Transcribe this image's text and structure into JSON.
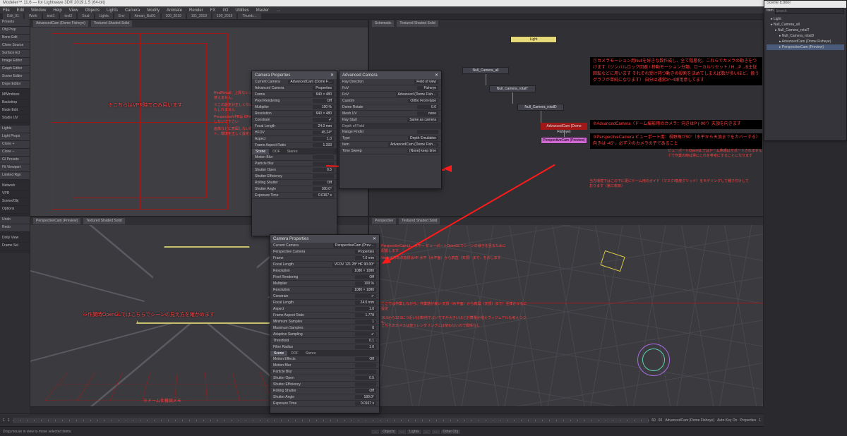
{
  "window": {
    "title": "Modeler™ 11.6 — for Lightwave 3D® 2019.1.5 (64-bit)"
  },
  "menu": [
    "File",
    "Edit",
    "Window",
    "Help",
    "View",
    "Objects",
    "Lights",
    "Camera",
    "Modify",
    "Animate",
    "Render",
    "FX",
    "I/O",
    "Utilities",
    "Master",
    "…"
  ],
  "tabs": [
    "Edit_01",
    "Work",
    "test1",
    "test2",
    "Stud",
    "Lights",
    "Env",
    "Atman_Bul01",
    "100_2019",
    "101_2019",
    "100_2019",
    "Thumb…"
  ],
  "left_tools": {
    "group1": [
      "Presets",
      "Obj Prop",
      "Bone Edit",
      "Clone Source",
      "Surface Ed",
      "Image Editor",
      "Graph Editor",
      "Scene Editor",
      "Dope Editor"
    ],
    "group2": [
      "MWindows",
      "Backdrop",
      "Node Edit",
      "Studio UV"
    ],
    "group3": [
      "Lights",
      "Light Props",
      "Clone +",
      "Clone −",
      "GI Presets",
      "Fit Viewport",
      "Limited Rgn"
    ],
    "group4": [
      "Network",
      "VPR",
      "Scene/Obj",
      "Options"
    ],
    "group5": [
      "Undo",
      "Redo"
    ],
    "group6": [
      "Dolly View",
      "Frame Sel"
    ]
  },
  "viewports": {
    "tl": {
      "camera": "AdvancedCam (Dome Fisheye)",
      "mode": "Textured Shaded Solid",
      "note1": "※こちらはVPR時でのみ用います",
      "side_notes": [
        "RealRecall：上質なレンダリング時はAdvancedCameraでしか使えません。",
        "※この設定が正しくない場合、これが正常に動作していないかもしれません",
        "PerspectiveVPRは HFov=90° で、（水平の線位と斜線）は被写しないで下さい",
        "画像などに意図しない影が出る場合は、上記を確認して（ライト、環境を正しく設定したことと対応してみて下さい）"
      ]
    },
    "tr": {
      "title": "Schematic",
      "mode": "Textured Shaded Solid",
      "nodes": {
        "light": "Light",
        "n1": "Null_Camera_all",
        "n2": "Null_Camera_rotalT",
        "n3": "Null_Camera_rotalD",
        "n4": "AdvancedCam (Dome Fisheye)",
        "n5": "PerspectiveCam (Preview)"
      },
      "annotations": {
        "box1": "①カメラモーション用Nullを好きな数作成し、全て階層化。これらでカメラの動きをつけます（ジンバルロック回避 / 移動モーション分類、ローカルリセット / H→P→B主従回転などに用います それぞれ受け持つ動きの役割を決めてしまえば数が多いほど、扱うグラフが単純になります） 自分は通常3〜4娘用意してます",
        "box2": "②AdvancedCamera（ドーム撮影用のカメラ：向きはP (-90°）天頂を向きます",
        "box3": "③PerspectiveCamera ビューポート用：視野角が90°（水平から天頂までをカバーする）向きは -45°、必ず②のカメラの子であること",
        "sub_note1": "ビューポートOpenGLではドーム魚眼はサポートされません ①で作業の時は常にこれを参考にすることになります",
        "sub_note2": "当方環境ではこの下に更にドーム用のガイド（マスク/角度グリッド）をモデリングして親子付けしております（第三枚目）"
      }
    },
    "bl": {
      "camera": "PerspectiveCam (Preview)",
      "mode": "Textured Shaded Solid",
      "note2": "※作業時OpenGLではこちらでシーンの見え方を確かめます",
      "bottom_note": "※ドーム仕様図メモ"
    },
    "br": {
      "camera": "Perspective",
      "mode": "Textured Shaded Solid"
    }
  },
  "panel_advanced": {
    "title": "Camera Properties",
    "current_camera": "AdvancedCam (Dome F…",
    "rows": [
      {
        "lab": "Advanced Camera",
        "val": "Properties"
      },
      {
        "lab": "Frame",
        "val": "640 × 480"
      },
      {
        "lab": "Pixel Rendering",
        "val": "Off"
      },
      {
        "lab": "Multiplier",
        "val": "100 %"
      },
      {
        "lab": "Resolution",
        "val": "640 × 480"
      },
      {
        "lab": "Constrain",
        "val": "✔"
      },
      {
        "lab": "Focal Length",
        "val": "24.0 mm"
      },
      {
        "lab": "HFOV",
        "val": "45.24°"
      },
      {
        "lab": "Aspect",
        "val": "1.0"
      },
      {
        "lab": "Frame Aspect Ratio",
        "val": "1.333"
      }
    ],
    "tabs": [
      "Scene",
      "DOF",
      "Stereo"
    ],
    "tab_rows": [
      {
        "lab": "Motion Blur",
        "val": ""
      },
      {
        "lab": "Particle Blur",
        "val": ""
      },
      {
        "lab": "Shutter Open",
        "val": "0.5"
      },
      {
        "lab": "Shutter Efficiency",
        "val": ""
      },
      {
        "lab": "Rolling Shutter",
        "val": "Off"
      },
      {
        "lab": "Shutter Angle",
        "val": "180.0°"
      },
      {
        "lab": "Exposure Time",
        "val": "0.0167 s"
      }
    ]
  },
  "panel_advanced_ext": {
    "title": "Advanced Camera",
    "rows": [
      {
        "lab": "Ray Direction",
        "val": "Field of view"
      },
      {
        "lab": "FoV",
        "val": "Fisheye"
      },
      {
        "lab": "FoV",
        "val": "Advanced (Dome Fish…"
      },
      {
        "lab": "Custom",
        "val": "Ortho Front-type"
      },
      {
        "lab": "Dome Rotate",
        "val": "0.0"
      },
      {
        "lab": "Mesh UV",
        "val": "none"
      },
      {
        "lab": "Ray Start",
        "val": "Same as camera"
      }
    ],
    "section": "Depth of Field",
    "dof_rows": [
      {
        "lab": "Range Finder",
        "val": ""
      },
      {
        "lab": "Type",
        "val": "Depth Emulation"
      },
      {
        "lab": "Item",
        "val": "AdvancedCam (Dome Fish…"
      },
      {
        "lab": "Time Sweep",
        "val": "[None] keep time"
      }
    ]
  },
  "panel_perspective": {
    "title": "Camera Properties",
    "current_camera": "PerspectiveCam (Prev…",
    "rows": [
      {
        "lab": "Perspective Camera",
        "val": "Properties"
      },
      {
        "lab": "Frame",
        "val": "7.0 mm"
      },
      {
        "lab": "Focal Length",
        "val": "VFOV 121.28° HF 90.00°"
      },
      {
        "lab": "Resolution",
        "val": "1080 × 1080"
      },
      {
        "lab": "Pixel Rendering",
        "val": "Off"
      },
      {
        "lab": "Multiplier",
        "val": "100 %"
      },
      {
        "lab": "Resolution",
        "val": "1080 × 1080"
      },
      {
        "lab": "Constrain",
        "val": "✔"
      },
      {
        "lab": "Focal Length",
        "val": "24.0 mm"
      },
      {
        "lab": "Aspect",
        "val": "1.0"
      },
      {
        "lab": "Frame Aspect Ratio",
        "val": "1.778"
      }
    ],
    "sampling_rows": [
      {
        "lab": "Minimum Samples",
        "val": "1"
      },
      {
        "lab": "Maximum Samples",
        "val": "8"
      },
      {
        "lab": "Adaptive Sampling",
        "val": "✔"
      },
      {
        "lab": "Threshold",
        "val": "0.1"
      },
      {
        "lab": "Filter Radius",
        "val": "1.0"
      }
    ],
    "tabs": [
      "Scene",
      "DOF",
      "Stereo"
    ],
    "blur_rows": [
      {
        "lab": "Motion Effects",
        "val": "Off"
      },
      {
        "lab": "Motion Blur",
        "val": ""
      },
      {
        "lab": "Particle Blur",
        "val": ""
      },
      {
        "lab": "Shutter Open",
        "val": "0.5"
      },
      {
        "lab": "Shutter Efficiency",
        "val": ""
      },
      {
        "lab": "Rolling Shutter",
        "val": "Off"
      },
      {
        "lab": "Shutter Angle",
        "val": "180.0°"
      },
      {
        "lab": "Exposure Time",
        "val": "0.0167 s"
      }
    ],
    "side_notes": {
      "a": "PerspectiveCamは、水平〜 ビューポートOpenGLでシーンの様子を見るために配置します",
      "b": "Vertical方向の指標はHF 水平（水平面）から真直（天頂）まで：を示します",
      "c": "ここでは作業しながら、作業感が良い  天頂（水平面）から真黒（天頂）まで！全体かけるに設定",
      "d": "16:9から12:9につ近い比率/他でよいですが大きいほど計算量が増えヴィジュアルも考えつつも",
      "e": "こちらのカメラは使うレンダリングには使わないので関係なし"
    }
  },
  "timeline": {
    "label_left": "1",
    "label_right": "60",
    "current_item": "AdvancedCam (Dome Fisheye)",
    "keys": "Auto Key  On",
    "props_btn": "Properties",
    "step": "1",
    "range_a": "1",
    "range_b": "1",
    "range_c": "60",
    "range_d": "60"
  },
  "status": {
    "left": "Drag mouse in view to move selected items",
    "mid_labels": [
      "…",
      "Objects",
      "…",
      "Lights",
      "…",
      "…",
      "Other Obj"
    ]
  },
  "scene_editor": {
    "title": "Scene Editor",
    "filter": "Item",
    "search_ph": "Search",
    "tree": [
      {
        "lvl": 0,
        "name": "Light"
      },
      {
        "lvl": 0,
        "name": "Null_Camera_all"
      },
      {
        "lvl": 1,
        "name": "Null_Camera_rotalT"
      },
      {
        "lvl": 2,
        "name": "Null_Camera_rotalD"
      },
      {
        "lvl": 2,
        "name": "AdvancedCam (Dome Fisheye)"
      },
      {
        "lvl": 2,
        "name": "PerspectiveCam (Preview)",
        "sel": true
      }
    ]
  }
}
